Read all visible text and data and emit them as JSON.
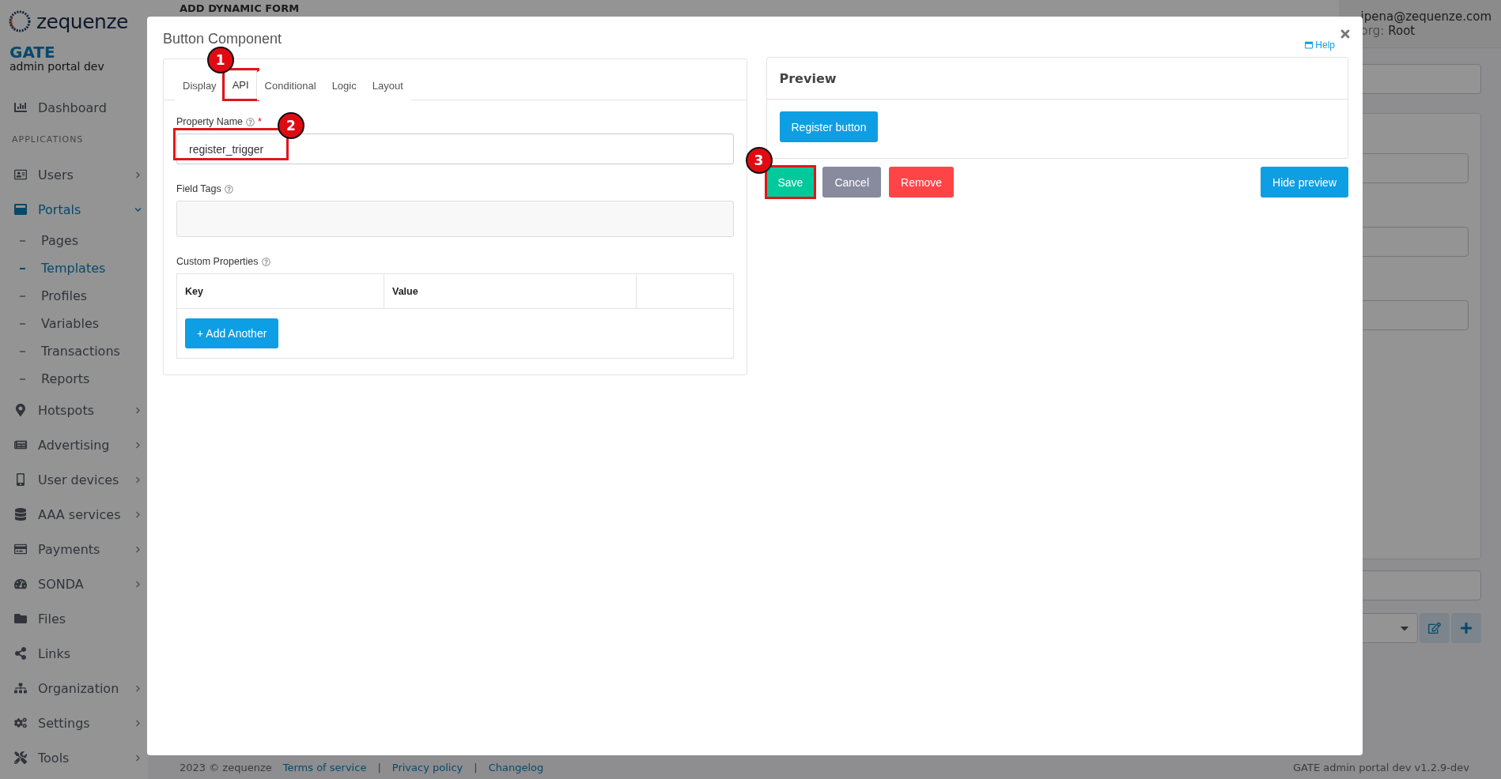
{
  "brand": {
    "logo": "zequenze",
    "product": "GATE",
    "subtitle": "admin portal dev"
  },
  "sidebar": {
    "top_item": {
      "label": "Dashboard",
      "selected": false
    },
    "section": "APPLICATIONS",
    "items": [
      {
        "label": "Users",
        "expandable": true,
        "expanded": false,
        "selected": false
      },
      {
        "label": "Portals",
        "expandable": true,
        "expanded": true,
        "selected": true,
        "children": [
          {
            "label": "Pages",
            "selected": false
          },
          {
            "label": "Templates",
            "selected": true
          },
          {
            "label": "Profiles",
            "selected": false
          },
          {
            "label": "Variables",
            "selected": false
          },
          {
            "label": "Transactions",
            "selected": false
          },
          {
            "label": "Reports",
            "selected": false
          }
        ]
      },
      {
        "label": "Hotspots",
        "expandable": true,
        "expanded": false,
        "selected": false
      },
      {
        "label": "Advertising",
        "expandable": true,
        "expanded": false,
        "selected": false
      },
      {
        "label": "User devices",
        "expandable": true,
        "expanded": false,
        "selected": false
      },
      {
        "label": "AAA services",
        "expandable": true,
        "expanded": false,
        "selected": false
      },
      {
        "label": "Payments",
        "expandable": true,
        "expanded": false,
        "selected": false
      },
      {
        "label": "SONDA",
        "expandable": true,
        "expanded": false,
        "selected": false
      },
      {
        "label": "Files",
        "expandable": false,
        "selected": false
      },
      {
        "label": "Links",
        "expandable": false,
        "selected": false
      },
      {
        "label": "Organization",
        "expandable": true,
        "expanded": false,
        "selected": false
      },
      {
        "label": "Settings",
        "expandable": true,
        "expanded": false,
        "selected": false
      },
      {
        "label": "Tools",
        "expandable": true,
        "expanded": false,
        "selected": false
      }
    ]
  },
  "header": {
    "page_title": "ADD DYNAMIC FORM",
    "user": {
      "email": "ipena@zequenze.com",
      "org_label": "org:",
      "org": "Root"
    }
  },
  "footer": {
    "copyright": "2023 © zequenze",
    "links": [
      "Terms of service",
      "Privacy policy",
      "Changelog"
    ],
    "separator": "|",
    "version": "GATE admin portal dev v1.2.9-dev"
  },
  "modal": {
    "title": "Button Component",
    "help": "Help",
    "tabs": [
      {
        "label": "Display",
        "selected": false
      },
      {
        "label": "API",
        "selected": true,
        "marker": "1"
      },
      {
        "label": "Conditional",
        "selected": false
      },
      {
        "label": "Logic",
        "selected": false
      },
      {
        "label": "Layout",
        "selected": false
      }
    ],
    "property_name": {
      "label": "Property Name",
      "required_mark": "*",
      "value": "register_trigger",
      "marker": "2"
    },
    "field_tags": {
      "label": "Field Tags"
    },
    "custom_properties": {
      "label": "Custom Properties",
      "columns": [
        "Key",
        "Value"
      ],
      "add_button": "+ Add Another"
    },
    "preview": {
      "title": "Preview",
      "button": "Register button"
    },
    "actions": [
      {
        "label": "Save",
        "kind": "save",
        "marker": "3"
      },
      {
        "label": "Cancel",
        "kind": "cancel"
      },
      {
        "label": "Remove",
        "kind": "remove"
      }
    ],
    "toggle_preview": "Hide preview"
  }
}
